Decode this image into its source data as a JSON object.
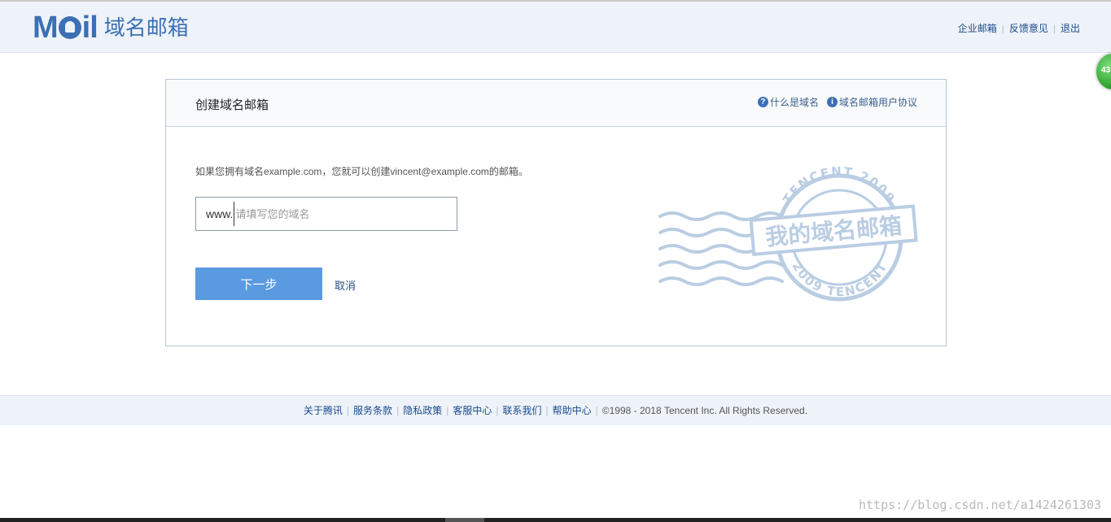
{
  "header": {
    "logo_mark": "MOil",
    "logo_text": "域名邮箱",
    "links": [
      "企业邮箱",
      "反馈意见",
      "退出"
    ]
  },
  "float_badge": "43",
  "panel": {
    "title": "创建域名邮箱",
    "help_links": [
      {
        "icon": "question-circle-icon",
        "glyph": "?",
        "label": "什么是域名"
      },
      {
        "icon": "info-circle-icon",
        "glyph": "i",
        "label": "域名邮箱用户协议"
      }
    ],
    "description": "如果您拥有域名example.com，您就可以创建vincent@example.com的邮箱。",
    "domain_prefix": "www.",
    "domain_input": {
      "value": "",
      "placeholder": "请填写您的域名"
    },
    "next_label": "下一步",
    "cancel_label": "取消",
    "stamp": {
      "text": "我的域名邮箱",
      "ring_top": "TENCENT 2009",
      "ring_bottom": "2009 TENCENT",
      "color": "#b9cde3"
    }
  },
  "footer": {
    "links": [
      "关于腾讯",
      "服务条款",
      "隐私政策",
      "客服中心",
      "联系我们",
      "帮助中心"
    ],
    "copyright": "©1998 - 2018 Tencent Inc. All Rights Reserved."
  },
  "watermark": "https://blog.csdn.net/a1424261303",
  "colors": {
    "brand": "#3b70b5",
    "button": "#5a9ae0",
    "header_bg": "#eef3f9",
    "link": "#1a4a8c"
  }
}
